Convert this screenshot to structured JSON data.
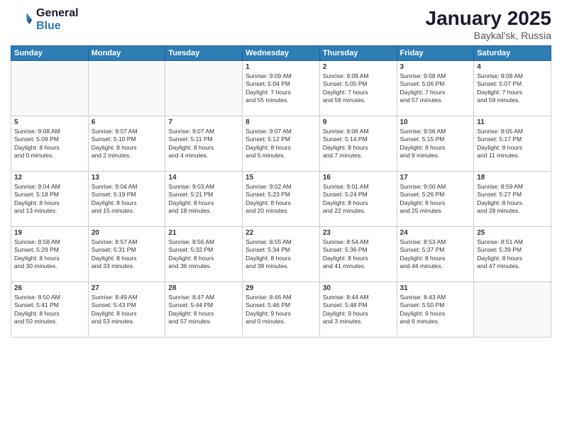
{
  "logo": {
    "line1": "General",
    "line2": "Blue"
  },
  "title": "January 2025",
  "location": "Baykal'sk, Russia",
  "weekdays": [
    "Sunday",
    "Monday",
    "Tuesday",
    "Wednesday",
    "Thursday",
    "Friday",
    "Saturday"
  ],
  "weeks": [
    [
      {
        "day": "",
        "info": "",
        "empty": true
      },
      {
        "day": "",
        "info": "",
        "empty": true
      },
      {
        "day": "",
        "info": "",
        "empty": true
      },
      {
        "day": "1",
        "info": "Sunrise: 9:09 AM\nSunset: 5:04 PM\nDaylight: 7 hours\nand 55 minutes.",
        "empty": false
      },
      {
        "day": "2",
        "info": "Sunrise: 9:09 AM\nSunset: 5:05 PM\nDaylight: 7 hours\nand 56 minutes.",
        "empty": false
      },
      {
        "day": "3",
        "info": "Sunrise: 9:08 AM\nSunset: 5:06 PM\nDaylight: 7 hours\nand 57 minutes.",
        "empty": false
      },
      {
        "day": "4",
        "info": "Sunrise: 9:08 AM\nSunset: 5:07 PM\nDaylight: 7 hours\nand 59 minutes.",
        "empty": false
      }
    ],
    [
      {
        "day": "5",
        "info": "Sunrise: 9:08 AM\nSunset: 5:09 PM\nDaylight: 8 hours\nand 0 minutes.",
        "empty": false
      },
      {
        "day": "6",
        "info": "Sunrise: 9:07 AM\nSunset: 5:10 PM\nDaylight: 8 hours\nand 2 minutes.",
        "empty": false
      },
      {
        "day": "7",
        "info": "Sunrise: 9:07 AM\nSunset: 5:11 PM\nDaylight: 8 hours\nand 4 minutes.",
        "empty": false
      },
      {
        "day": "8",
        "info": "Sunrise: 9:07 AM\nSunset: 5:12 PM\nDaylight: 8 hours\nand 5 minutes.",
        "empty": false
      },
      {
        "day": "9",
        "info": "Sunrise: 9:06 AM\nSunset: 5:14 PM\nDaylight: 8 hours\nand 7 minutes.",
        "empty": false
      },
      {
        "day": "10",
        "info": "Sunrise: 9:06 AM\nSunset: 5:15 PM\nDaylight: 8 hours\nand 9 minutes.",
        "empty": false
      },
      {
        "day": "11",
        "info": "Sunrise: 9:05 AM\nSunset: 5:17 PM\nDaylight: 8 hours\nand 11 minutes.",
        "empty": false
      }
    ],
    [
      {
        "day": "12",
        "info": "Sunrise: 9:04 AM\nSunset: 5:18 PM\nDaylight: 8 hours\nand 13 minutes.",
        "empty": false
      },
      {
        "day": "13",
        "info": "Sunrise: 9:04 AM\nSunset: 5:19 PM\nDaylight: 8 hours\nand 15 minutes.",
        "empty": false
      },
      {
        "day": "14",
        "info": "Sunrise: 9:03 AM\nSunset: 5:21 PM\nDaylight: 8 hours\nand 18 minutes.",
        "empty": false
      },
      {
        "day": "15",
        "info": "Sunrise: 9:02 AM\nSunset: 5:23 PM\nDaylight: 8 hours\nand 20 minutes.",
        "empty": false
      },
      {
        "day": "16",
        "info": "Sunrise: 9:01 AM\nSunset: 5:24 PM\nDaylight: 8 hours\nand 22 minutes.",
        "empty": false
      },
      {
        "day": "17",
        "info": "Sunrise: 9:00 AM\nSunset: 5:26 PM\nDaylight: 8 hours\nand 25 minutes.",
        "empty": false
      },
      {
        "day": "18",
        "info": "Sunrise: 8:59 AM\nSunset: 5:27 PM\nDaylight: 8 hours\nand 28 minutes.",
        "empty": false
      }
    ],
    [
      {
        "day": "19",
        "info": "Sunrise: 8:58 AM\nSunset: 5:29 PM\nDaylight: 8 hours\nand 30 minutes.",
        "empty": false
      },
      {
        "day": "20",
        "info": "Sunrise: 8:57 AM\nSunset: 5:31 PM\nDaylight: 8 hours\nand 33 minutes.",
        "empty": false
      },
      {
        "day": "21",
        "info": "Sunrise: 8:56 AM\nSunset: 5:32 PM\nDaylight: 8 hours\nand 36 minutes.",
        "empty": false
      },
      {
        "day": "22",
        "info": "Sunrise: 8:55 AM\nSunset: 5:34 PM\nDaylight: 8 hours\nand 38 minutes.",
        "empty": false
      },
      {
        "day": "23",
        "info": "Sunrise: 8:54 AM\nSunset: 5:36 PM\nDaylight: 8 hours\nand 41 minutes.",
        "empty": false
      },
      {
        "day": "24",
        "info": "Sunrise: 8:53 AM\nSunset: 5:37 PM\nDaylight: 8 hours\nand 44 minutes.",
        "empty": false
      },
      {
        "day": "25",
        "info": "Sunrise: 8:51 AM\nSunset: 5:39 PM\nDaylight: 8 hours\nand 47 minutes.",
        "empty": false
      }
    ],
    [
      {
        "day": "26",
        "info": "Sunrise: 8:50 AM\nSunset: 5:41 PM\nDaylight: 8 hours\nand 50 minutes.",
        "empty": false
      },
      {
        "day": "27",
        "info": "Sunrise: 8:49 AM\nSunset: 5:43 PM\nDaylight: 8 hours\nand 53 minutes.",
        "empty": false
      },
      {
        "day": "28",
        "info": "Sunrise: 8:47 AM\nSunset: 5:44 PM\nDaylight: 8 hours\nand 57 minutes.",
        "empty": false
      },
      {
        "day": "29",
        "info": "Sunrise: 8:46 AM\nSunset: 5:46 PM\nDaylight: 9 hours\nand 0 minutes.",
        "empty": false
      },
      {
        "day": "30",
        "info": "Sunrise: 8:44 AM\nSunset: 5:48 PM\nDaylight: 9 hours\nand 3 minutes.",
        "empty": false
      },
      {
        "day": "31",
        "info": "Sunrise: 8:43 AM\nSunset: 5:50 PM\nDaylight: 9 hours\nand 6 minutes.",
        "empty": false
      },
      {
        "day": "",
        "info": "",
        "empty": true
      }
    ]
  ]
}
